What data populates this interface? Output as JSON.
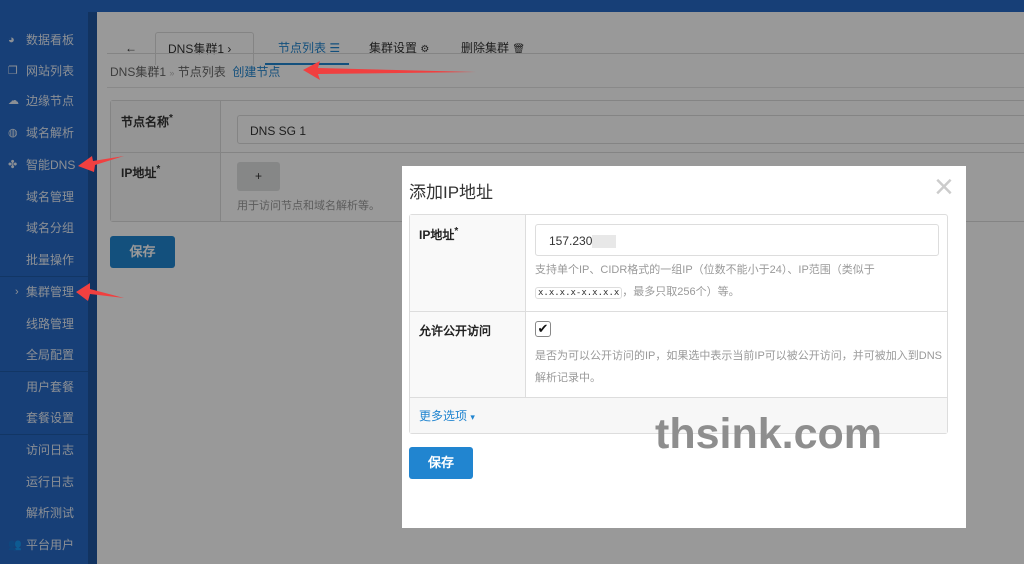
{
  "sidebar": {
    "items": [
      {
        "label": "数据看板",
        "icon": "dashboard-icon"
      },
      {
        "label": "网站列表",
        "icon": "clone-icon"
      },
      {
        "label": "边缘节点",
        "icon": "cloud-icon"
      },
      {
        "label": "域名解析",
        "icon": "globe-icon"
      },
      {
        "label": "智能DNS",
        "icon": "cubes-icon"
      },
      {
        "label": "域名管理"
      },
      {
        "label": "域名分组"
      },
      {
        "label": "批量操作"
      },
      {
        "label": "集群管理",
        "active": true
      },
      {
        "label": "线路管理"
      },
      {
        "label": "全局配置"
      },
      {
        "label": "用户套餐"
      },
      {
        "label": "套餐设置"
      },
      {
        "label": "访问日志"
      },
      {
        "label": "运行日志"
      },
      {
        "label": "解析测试"
      },
      {
        "label": "平台用户",
        "icon": "users-icon"
      }
    ]
  },
  "tabs": {
    "back": "←",
    "cluster": "DNS集群1",
    "nodes": "节点列表",
    "settings": "集群设置",
    "delete": "删除集群"
  },
  "breadcrumb": {
    "cluster": "DNS集群1",
    "sep": "»",
    "nodes": "节点列表",
    "current": "创建节点"
  },
  "form": {
    "name_label": "节点名称",
    "name_value": "DNS SG 1",
    "ip_label": "IP地址",
    "add": "+",
    "ip_help": "用于访问节点和域名解析等。",
    "save": "保存",
    "required": "*"
  },
  "modal": {
    "title": "添加IP地址",
    "close": "×",
    "ip_label": "IP地址",
    "ip_value": "157.230",
    "ip_help_1": "支持单个IP、CIDR格式的一组IP（位数不能小于24）、IP范围（类似于",
    "ip_help_code": "x.x.x.x-x.x.x.x",
    "ip_help_2": "，最多只取256个）等。",
    "public_label": "允许公开访问",
    "public_checked": true,
    "public_help": "是否为可以公开访问的IP，如果选中表示当前IP可以被公开访问，并可被加入到DNS解析记录中。",
    "more": "更多选项",
    "save": "保存"
  },
  "watermark": "thsink.com",
  "colors": {
    "accent": "#2185d0",
    "sidebar": "#276ac6",
    "arrow": "#f04040"
  }
}
